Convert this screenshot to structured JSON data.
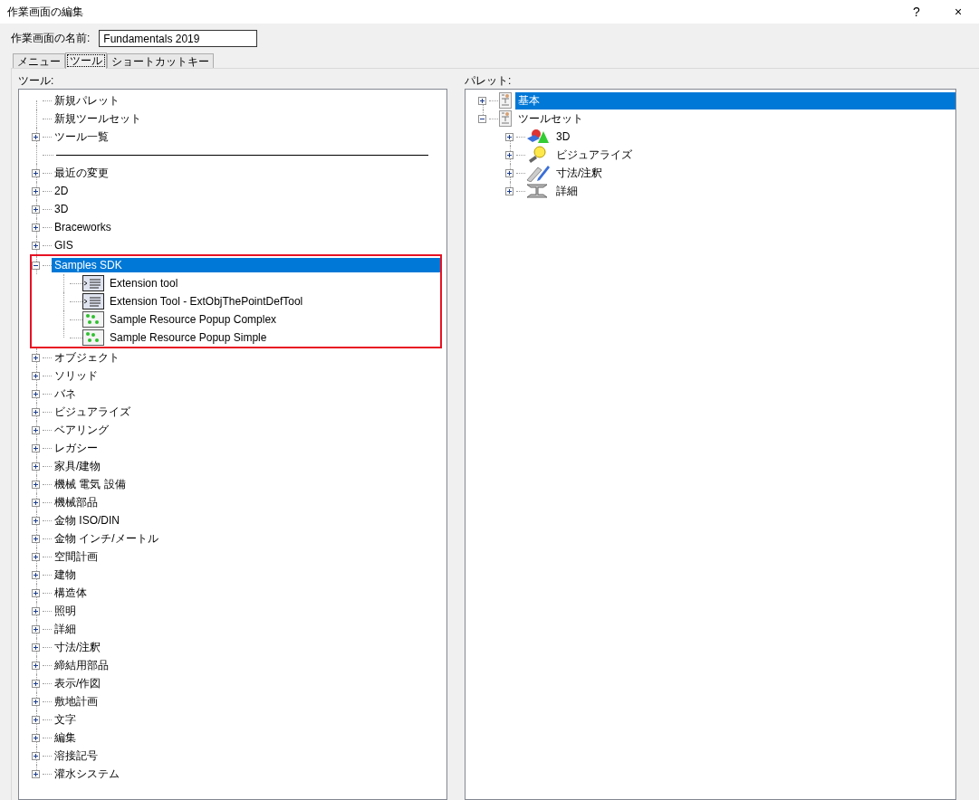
{
  "window": {
    "title": "作業画面の編集",
    "help": "?",
    "close": "×"
  },
  "name_field": {
    "label": "作業画面の名前:",
    "value": "Fundamentals 2019"
  },
  "tabs": [
    {
      "label": "メニュー",
      "selected": false
    },
    {
      "label": "ツール",
      "selected": true
    },
    {
      "label": "ショートカットキー",
      "selected": false
    }
  ],
  "tools_panel": {
    "label": "ツール:",
    "items": [
      {
        "kind": "leaf",
        "label": "新規パレット",
        "selected": false
      },
      {
        "kind": "leaf",
        "label": "新規ツールセット",
        "selected": false
      },
      {
        "kind": "group",
        "label": "ツール一覧",
        "expanded": false,
        "selected": false
      },
      {
        "kind": "separator"
      },
      {
        "kind": "group",
        "label": "最近の変更",
        "expanded": false,
        "selected": false
      },
      {
        "kind": "group",
        "label": "2D",
        "expanded": false,
        "selected": false
      },
      {
        "kind": "group",
        "label": "3D",
        "expanded": false,
        "selected": false
      },
      {
        "kind": "group",
        "label": "Braceworks",
        "expanded": false,
        "selected": false
      },
      {
        "kind": "group",
        "label": "GIS",
        "expanded": false,
        "selected": false
      },
      {
        "kind": "group",
        "label": "Samples SDK",
        "expanded": true,
        "selected": true,
        "highlighted": true,
        "children": [
          {
            "kind": "extension",
            "label": "Extension tool",
            "selected": false
          },
          {
            "kind": "extension",
            "label": "Extension Tool - ExtObjThePointDefTool",
            "selected": false
          },
          {
            "kind": "popup",
            "label": "Sample Resource Popup Complex",
            "selected": false
          },
          {
            "kind": "popup",
            "label": "Sample Resource Popup Simple",
            "selected": false
          }
        ]
      },
      {
        "kind": "group",
        "label": "オブジェクト",
        "expanded": false,
        "selected": false
      },
      {
        "kind": "group",
        "label": "ソリッド",
        "expanded": false,
        "selected": false
      },
      {
        "kind": "group",
        "label": "バネ",
        "expanded": false,
        "selected": false
      },
      {
        "kind": "group",
        "label": "ビジュアライズ",
        "expanded": false,
        "selected": false
      },
      {
        "kind": "group",
        "label": "ベアリング",
        "expanded": false,
        "selected": false
      },
      {
        "kind": "group",
        "label": "レガシー",
        "expanded": false,
        "selected": false
      },
      {
        "kind": "group",
        "label": "家具/建物",
        "expanded": false,
        "selected": false
      },
      {
        "kind": "group",
        "label": "機械 電気 設備",
        "expanded": false,
        "selected": false
      },
      {
        "kind": "group",
        "label": "機械部品",
        "expanded": false,
        "selected": false
      },
      {
        "kind": "group",
        "label": "金物 ISO/DIN",
        "expanded": false,
        "selected": false
      },
      {
        "kind": "group",
        "label": "金物 インチ/メートル",
        "expanded": false,
        "selected": false
      },
      {
        "kind": "group",
        "label": "空間計画",
        "expanded": false,
        "selected": false
      },
      {
        "kind": "group",
        "label": "建物",
        "expanded": false,
        "selected": false
      },
      {
        "kind": "group",
        "label": "構造体",
        "expanded": false,
        "selected": false
      },
      {
        "kind": "group",
        "label": "照明",
        "expanded": false,
        "selected": false
      },
      {
        "kind": "group",
        "label": "詳細",
        "expanded": false,
        "selected": false
      },
      {
        "kind": "group",
        "label": "寸法/注釈",
        "expanded": false,
        "selected": false
      },
      {
        "kind": "group",
        "label": "締結用部品",
        "expanded": false,
        "selected": false
      },
      {
        "kind": "group",
        "label": "表示/作図",
        "expanded": false,
        "selected": false
      },
      {
        "kind": "group",
        "label": "敷地計画",
        "expanded": false,
        "selected": false
      },
      {
        "kind": "group",
        "label": "文字",
        "expanded": false,
        "selected": false
      },
      {
        "kind": "group",
        "label": "編集",
        "expanded": false,
        "selected": false
      },
      {
        "kind": "group",
        "label": "溶接記号",
        "expanded": false,
        "selected": false
      },
      {
        "kind": "group",
        "label": "灌水システム",
        "expanded": false,
        "selected": false
      }
    ]
  },
  "palette_panel": {
    "label": "パレット:",
    "items": [
      {
        "label": "基本",
        "expanded": false,
        "selected": true
      },
      {
        "label": "ツールセット",
        "expanded": true,
        "selected": false,
        "children": [
          {
            "label": "3D",
            "expanded": false,
            "selected": false
          },
          {
            "label": "ビジュアライズ",
            "expanded": false,
            "selected": false
          },
          {
            "label": "寸法/注釈",
            "expanded": false,
            "selected": false
          },
          {
            "label": "詳細",
            "expanded": false,
            "selected": false
          }
        ]
      }
    ]
  }
}
